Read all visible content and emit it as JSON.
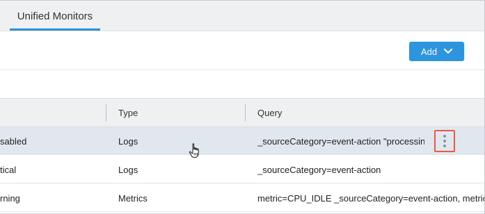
{
  "tabs": [
    {
      "label": "Unified Monitors",
      "active": true
    }
  ],
  "toolbar": {
    "add_label": "Add",
    "add_icon": "chevron-down-icon"
  },
  "table": {
    "columns": [
      "",
      "Type",
      "Query"
    ],
    "rows": [
      {
        "status": "sabled",
        "type": "Logs",
        "query": "_sourceCategory=event-action \"processing ev",
        "selected": true
      },
      {
        "status": "tical",
        "type": "Logs",
        "query": "_sourceCategory=event-action",
        "selected": false
      },
      {
        "status": "rning",
        "type": "Metrics",
        "query": "metric=CPU_IDLE _sourceCategory=event-action, metric=C",
        "selected": false
      }
    ]
  },
  "colors": {
    "accent": "#2c95dd",
    "tab_underline": "#2a8fd6",
    "highlight_border": "#e45a45",
    "selected_row": "#e1e7ee"
  }
}
